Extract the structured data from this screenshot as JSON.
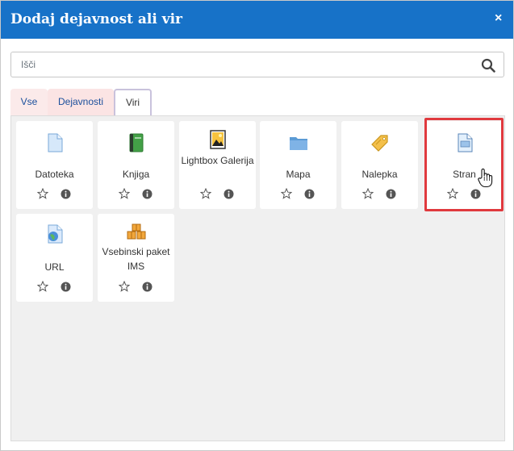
{
  "dialog": {
    "title": "Dodaj dejavnost ali vir",
    "close_glyph": "×"
  },
  "search": {
    "placeholder": "Išči",
    "icon": "search-icon"
  },
  "tabs": [
    {
      "label": "Vse"
    },
    {
      "label": "Dejavnosti"
    },
    {
      "label": "Viri",
      "selected": true
    }
  ],
  "modules": [
    {
      "name": "Datoteka",
      "icon": "file-icon"
    },
    {
      "name": "Knjiga",
      "icon": "book-icon"
    },
    {
      "name": "Lightbox Galerija",
      "icon": "gallery-icon"
    },
    {
      "name": "Mapa",
      "icon": "folder-icon"
    },
    {
      "name": "Nalepka",
      "icon": "label-icon"
    },
    {
      "name": "Stran",
      "icon": "page-icon",
      "highlighted": true
    },
    {
      "name": "URL",
      "icon": "url-icon"
    },
    {
      "name": "Vsebinski paket IMS",
      "icon": "ims-package-icon"
    }
  ],
  "colors": {
    "header": "#1772c8",
    "highlight": "#e0393e"
  }
}
